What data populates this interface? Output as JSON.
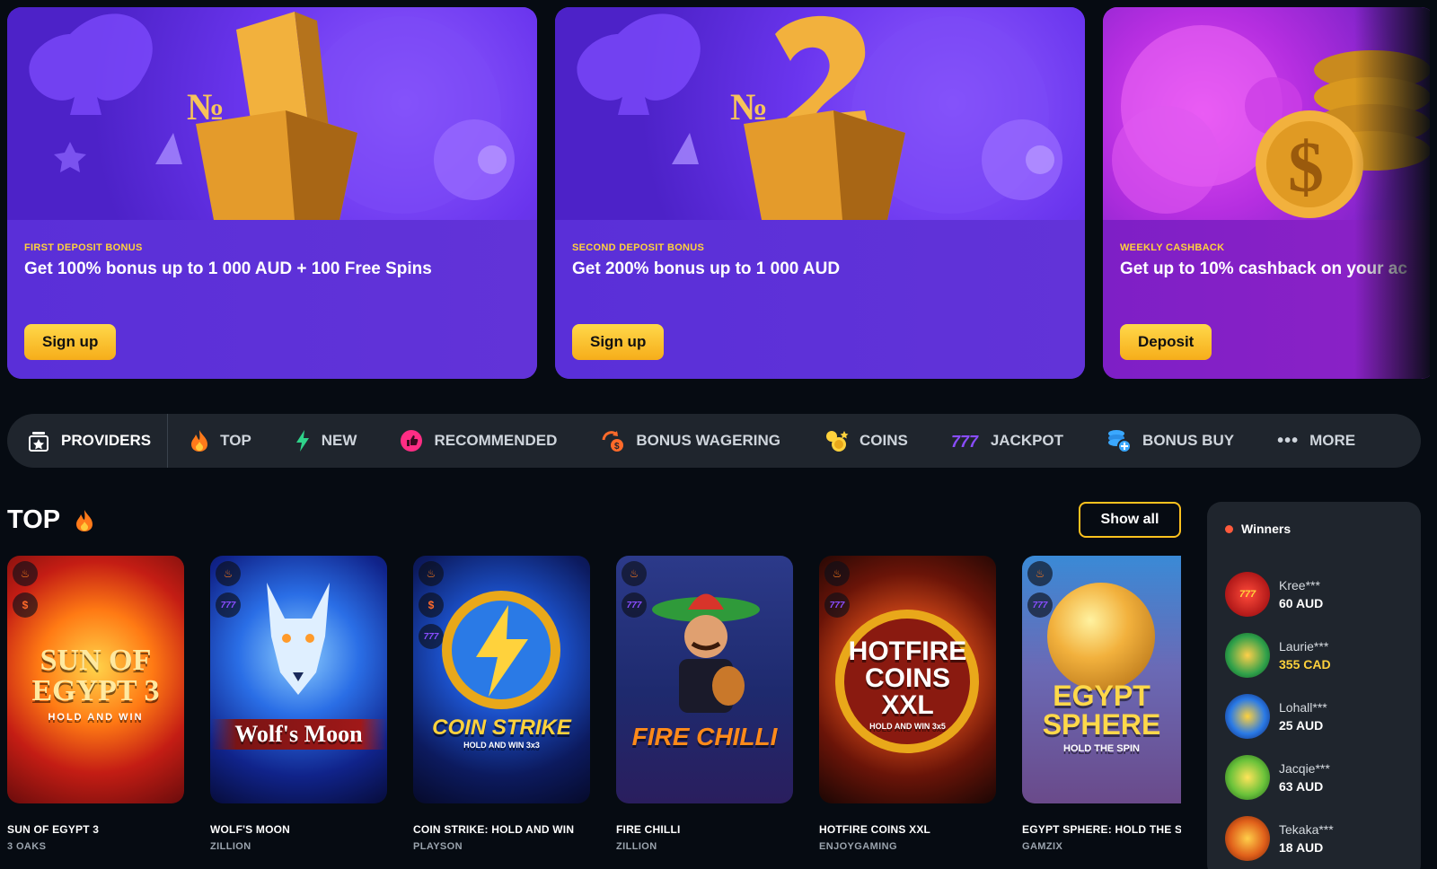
{
  "promos": [
    {
      "kicker": "FIRST DEPOSIT BONUS",
      "headline": "Get 100% bonus up to 1 000 AUD + 100 Free Spins",
      "cta": "Sign up",
      "art_label": "№1"
    },
    {
      "kicker": "SECOND DEPOSIT BONUS",
      "headline": "Get 200% bonus up to 1 000 AUD",
      "cta": "Sign up",
      "art_label": "№2"
    },
    {
      "kicker": "WEEKLY CASHBACK",
      "headline": "Get up to 10% cashback on your ac",
      "cta": "Deposit",
      "art_label": "$"
    }
  ],
  "categories": {
    "providers": "PROVIDERS",
    "top": "TOP",
    "new": "NEW",
    "recommended": "RECOMMENDED",
    "bonus_wagering": "BONUS WAGERING",
    "coins": "COINS",
    "jackpot": "JACKPOT",
    "bonus_buy": "BONUS BUY",
    "more": "MORE"
  },
  "section": {
    "title": "TOP",
    "show_all": "Show all"
  },
  "games": [
    {
      "name": "SUN OF EGYPT 3",
      "provider": "3 OAKS",
      "logo": "SUN OF EGYPT 3",
      "sub": "HOLD AND WIN"
    },
    {
      "name": "WOLF'S MOON",
      "provider": "ZILLION",
      "logo": "Wolf's Moon",
      "sub": ""
    },
    {
      "name": "COIN STRIKE: HOLD AND WIN",
      "provider": "PLAYSON",
      "logo": "COIN STRIKE",
      "sub": "HOLD AND WIN 3x3"
    },
    {
      "name": "FIRE CHILLI",
      "provider": "ZILLION",
      "logo": "FIRE CHILLI",
      "sub": ""
    },
    {
      "name": "HOTFIRE COINS XXL",
      "provider": "ENJOYGAMING",
      "logo": "HOTFIRE COINS XXL",
      "sub": "HOLD AND WIN 3x5"
    },
    {
      "name": "EGYPT SPHERE: HOLD THE SP",
      "provider": "GAMZIX",
      "logo": "EGYPT SPHERE",
      "sub": "HOLD THE SPIN"
    }
  ],
  "winners": {
    "title": "Winners",
    "items": [
      {
        "user": "Kree***",
        "amount": "60 AUD"
      },
      {
        "user": "Laurie***",
        "amount": "355 CAD"
      },
      {
        "user": "Lohall***",
        "amount": "25 AUD"
      },
      {
        "user": "Jacqie***",
        "amount": "63 AUD"
      },
      {
        "user": "Tekaka***",
        "amount": "18 AUD"
      }
    ]
  },
  "colors": {
    "accent": "#ffc21e",
    "highlight_amount": "#ffd23c",
    "bar_bg": "#1f252d",
    "page_bg": "#060b12"
  }
}
